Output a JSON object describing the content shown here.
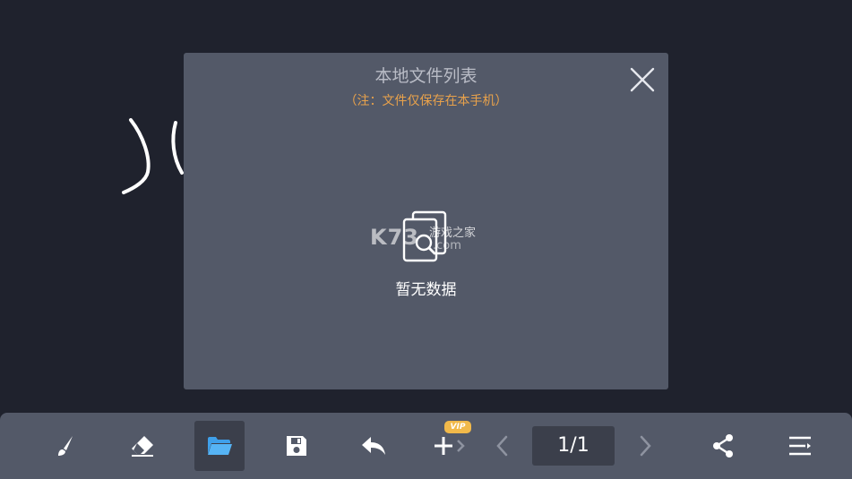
{
  "dialog": {
    "title": "本地文件列表",
    "note": "（注：文件仅保存在本手机）",
    "empty_text": "暂无数据",
    "watermark_logo_text": "K73 游戏之家 .com"
  },
  "toolbar": {
    "vip_badge": "VIP",
    "page_indicator": "1/1"
  },
  "icons": {
    "brush": "brush-icon",
    "eraser": "eraser-icon",
    "folder": "folder-open-icon",
    "save": "save-icon",
    "undo": "undo-icon",
    "add": "add-page-icon",
    "prev": "chevron-left-icon",
    "next": "chevron-right-icon",
    "share": "share-icon",
    "menu": "menu-icon",
    "close": "close-icon",
    "empty": "empty-search-icon"
  },
  "colors": {
    "canvas": "#1f222d",
    "panel": "#535968",
    "active_tool": "#3b3f4b",
    "folder_accent": "#3fa0ea",
    "note": "#e9a24b",
    "vip": "#f1b94a"
  }
}
